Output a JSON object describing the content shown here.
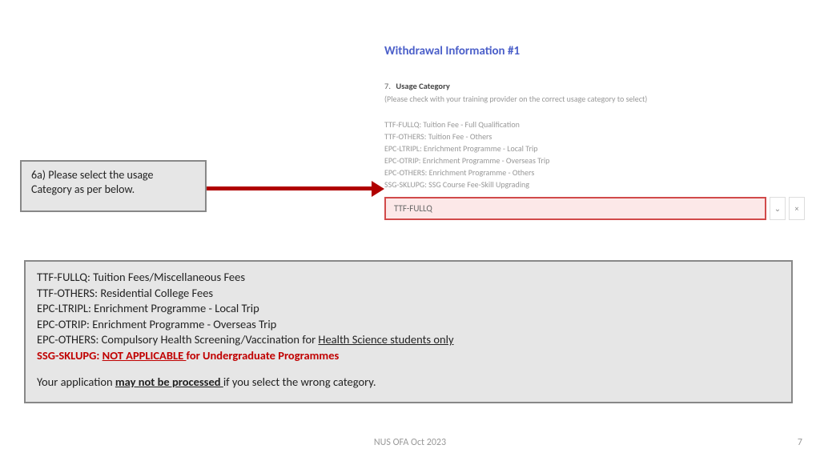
{
  "form": {
    "title": "Withdrawal Information #1",
    "field_num": "7.",
    "field_name": "Usage Category",
    "hint": "(Please check with your training provider on the correct usage category to select)",
    "options": [
      "TTF-FULLQ: Tuition Fee - Full Qualification",
      "TTF-OTHERS: Tuition Fee - Others",
      "EPC-LTRIPL: Enrichment Programme - Local Trip",
      "EPC-OTRIP: Enrichment Programme - Overseas Trip",
      "EPC-OTHERS: Enrichment Programme - Others",
      "SSG-SKLUPG: SSG Course Fee-Skill Upgrading"
    ],
    "selected": "TTF-FULLQ"
  },
  "callout": {
    "line1": "6a) Please select the usage",
    "line2": "Category as per below."
  },
  "info": {
    "line1": "TTF-FULLQ: Tuition Fees/Miscellaneous Fees",
    "line2": "TTF-OTHERS: Residential College Fees",
    "line3": "EPC-LTRIPL: Enrichment Programme - Local Trip",
    "line4": "EPC-OTRIP: Enrichment Programme - Overseas Trip",
    "line5a": "EPC-OTHERS: Compulsory Health Screening/Vaccination for ",
    "line5b": "Health Science students only",
    "line6a": "SSG-SKLUPG: ",
    "line6b": "NOT APPLICABLE ",
    "line6c": "for Undergraduate Programmes",
    "line7a": "Your application ",
    "line7b": "may not be processed ",
    "line7c": "if you select the wrong category."
  },
  "footer": "NUS OFA Oct 2023",
  "page": "7"
}
